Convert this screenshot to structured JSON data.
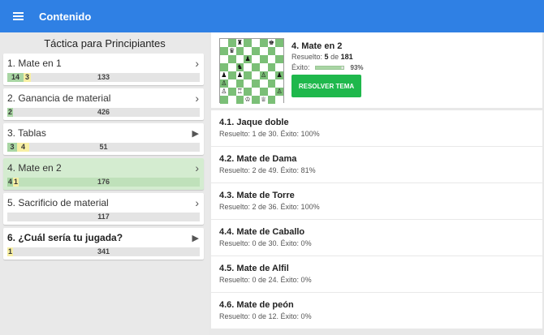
{
  "appbar": {
    "title": "Contenido"
  },
  "left": {
    "title": "Táctica para Principiantes",
    "topics": [
      {
        "label": "1. Mate en 1",
        "arrow": "›",
        "green": "14",
        "yellow": "3",
        "rest": "133"
      },
      {
        "label": "2. Ganancia de material",
        "arrow": "›",
        "green": "2",
        "yellow": "",
        "rest": "426"
      },
      {
        "label": "3. Tablas",
        "arrow": "▶",
        "green": "3",
        "yellow": "4",
        "rest": "51"
      },
      {
        "label": "4. Mate en 2",
        "arrow": "›",
        "green": "4",
        "yellow": "1",
        "rest": "176"
      },
      {
        "label": "5. Sacrificio de material",
        "arrow": "›",
        "green": "",
        "yellow": "",
        "rest": "117"
      },
      {
        "label": "6. ¿Cuál sería tu jugada?",
        "arrow": "▶",
        "green": "",
        "yellow": "1",
        "rest": "341"
      }
    ]
  },
  "header": {
    "title": "4. Mate en 2",
    "resuelto_label": "Resuelto:",
    "resuelto_value": "5",
    "resuelto_of": "de",
    "resuelto_total": "181",
    "exito_label": "Éxito:",
    "exito_pct": "93%",
    "exito_fraction": 0.93,
    "button": "RESOLVER TEMA"
  },
  "board": [
    [
      "",
      "",
      "♜",
      "",
      "",
      "",
      "♚",
      ""
    ],
    [
      "",
      "♛",
      "",
      "",
      "",
      "",
      "",
      ""
    ],
    [
      "",
      "",
      "",
      "♟",
      "",
      "",
      "",
      ""
    ],
    [
      "",
      "",
      "♞",
      "",
      "",
      "",
      "",
      ""
    ],
    [
      "♟",
      "",
      "♟",
      "",
      "",
      "♙",
      "",
      "♟"
    ],
    [
      "♙",
      "",
      "",
      "",
      "",
      "",
      "",
      ""
    ],
    [
      "♙",
      "",
      "♖",
      "",
      "",
      "",
      "",
      "♙"
    ],
    [
      "",
      "",
      "",
      "♔",
      "",
      "♕",
      "",
      ""
    ]
  ],
  "subtopics": [
    {
      "title": "4.1. Jaque doble",
      "result": "Resuelto: 1 de 30. Éxito: 100%"
    },
    {
      "title": "4.2. Mate de Dama",
      "result": "Resuelto: 2 de 49. Éxito: 81%"
    },
    {
      "title": "4.3. Mate de Torre",
      "result": "Resuelto: 2 de 36. Éxito: 100%"
    },
    {
      "title": "4.4. Mate de Caballo",
      "result": "Resuelto: 0 de 30. Éxito: 0%"
    },
    {
      "title": "4.5. Mate de Alfil",
      "result": "Resuelto: 0 de 24. Éxito: 0%"
    },
    {
      "title": "4.6. Mate de peón",
      "result": "Resuelto: 0 de 12. Éxito: 0%"
    }
  ],
  "colors": {
    "appbar": "#2f80e4",
    "button": "#1fb84c",
    "selected": "#d4ecd0",
    "bar_green": "#a9d6a4",
    "bar_yellow": "#f7efa4"
  }
}
